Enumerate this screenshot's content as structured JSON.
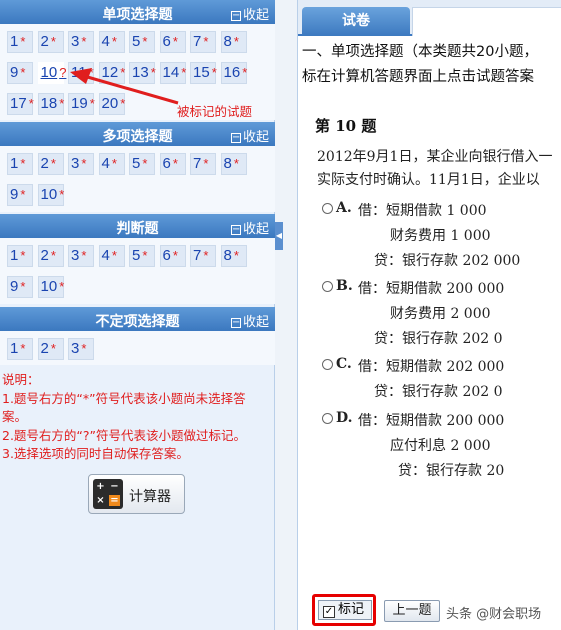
{
  "left_panel": {
    "collapse_label": "收起",
    "sections": [
      {
        "title": "单项选择题",
        "questions": [
          {
            "num": "1",
            "mark": "*"
          },
          {
            "num": "2",
            "mark": "*"
          },
          {
            "num": "3",
            "mark": "*"
          },
          {
            "num": "4",
            "mark": "*"
          },
          {
            "num": "5",
            "mark": "*"
          },
          {
            "num": "6",
            "mark": "*"
          },
          {
            "num": "7",
            "mark": "*"
          },
          {
            "num": "8",
            "mark": "*"
          },
          {
            "num": "9",
            "mark": "*"
          },
          {
            "num": "10",
            "mark": "?"
          },
          {
            "num": "11",
            "mark": "*"
          },
          {
            "num": "12",
            "mark": "*"
          },
          {
            "num": "13",
            "mark": "*"
          },
          {
            "num": "14",
            "mark": "*"
          },
          {
            "num": "15",
            "mark": "*"
          },
          {
            "num": "16",
            "mark": "*"
          },
          {
            "num": "17",
            "mark": "*"
          },
          {
            "num": "18",
            "mark": "*"
          },
          {
            "num": "19",
            "mark": "*"
          },
          {
            "num": "20",
            "mark": "*"
          }
        ]
      },
      {
        "title": "多项选择题",
        "questions": [
          {
            "num": "1",
            "mark": "*"
          },
          {
            "num": "2",
            "mark": "*"
          },
          {
            "num": "3",
            "mark": "*"
          },
          {
            "num": "4",
            "mark": "*"
          },
          {
            "num": "5",
            "mark": "*"
          },
          {
            "num": "6",
            "mark": "*"
          },
          {
            "num": "7",
            "mark": "*"
          },
          {
            "num": "8",
            "mark": "*"
          },
          {
            "num": "9",
            "mark": "*"
          },
          {
            "num": "10",
            "mark": "*"
          }
        ]
      },
      {
        "title": "判断题",
        "questions": [
          {
            "num": "1",
            "mark": "*"
          },
          {
            "num": "2",
            "mark": "*"
          },
          {
            "num": "3",
            "mark": "*"
          },
          {
            "num": "4",
            "mark": "*"
          },
          {
            "num": "5",
            "mark": "*"
          },
          {
            "num": "6",
            "mark": "*"
          },
          {
            "num": "7",
            "mark": "*"
          },
          {
            "num": "8",
            "mark": "*"
          },
          {
            "num": "9",
            "mark": "*"
          },
          {
            "num": "10",
            "mark": "*"
          }
        ]
      },
      {
        "title": "不定项选择题",
        "questions": [
          {
            "num": "1",
            "mark": "*"
          },
          {
            "num": "2",
            "mark": "*"
          },
          {
            "num": "3",
            "mark": "*"
          }
        ]
      }
    ],
    "notes": [
      "说明：",
      "1.题号右方的“*”符号代表该小题尚未选择答",
      "案。",
      "2.题号右方的“?”符号代表该小题做过标记。",
      "3.选择选项的同时自动保存答案。"
    ],
    "calculator_label": "计算器",
    "annotation_label": "被标记的试题"
  },
  "right_panel": {
    "tab_label": "试卷",
    "section_desc": [
      "一、单项选择题（本类题共20小题，",
      "标在计算机答题界面上点击试题答案"
    ],
    "question_title": "第 10 题",
    "stem": [
      "2012年9月1日，某企业向银行借入一",
      "实际支付时确认。11月1日，企业以"
    ],
    "options": [
      {
        "letter": "A.",
        "lines": [
          "借：短期借款    1 000",
          "财务费用    1 000",
          "贷：银行存款          202 000"
        ]
      },
      {
        "letter": "B.",
        "lines": [
          "借：短期借款   200 000",
          "财务费用     2 000",
          "贷：银行存款          202 0"
        ]
      },
      {
        "letter": "C.",
        "lines": [
          "借：短期借款   202 000",
          "贷：银行存款          202 0"
        ]
      },
      {
        "letter": "D.",
        "lines": [
          "借：短期借款      200 000",
          "应付利息       2 000",
          "贷：银行存款          20"
        ]
      }
    ],
    "mark_label": "标记",
    "prev_label": "上一题",
    "watermark": "头条 @财会职场"
  }
}
